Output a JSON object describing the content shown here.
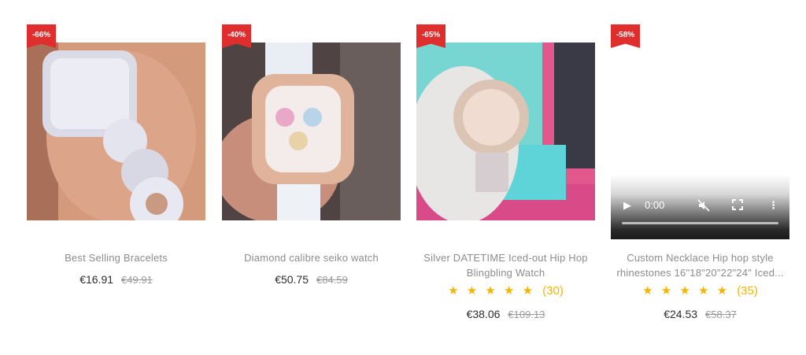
{
  "products": [
    {
      "badge": "-66%",
      "title_lines": [
        "Best Selling Bracelets"
      ],
      "price": "€16.91",
      "old_price": "€49.91",
      "colors": {
        "bg": "#c98a6e",
        "fg": "#e8e8f0"
      }
    },
    {
      "badge": "-40%",
      "title_lines": [
        "Diamond calibre seiko watch"
      ],
      "price": "€50.75",
      "old_price": "€84.59",
      "colors": {
        "bg": "#5a4a48",
        "fg": "#f2e6e0"
      }
    },
    {
      "badge": "-65%",
      "title_lines": [
        "Silver DATETIME Iced-out Hip Hop",
        "Blingbling Watch"
      ],
      "rating_stars": "★ ★ ★ ★ ★",
      "rating_count": "(30)",
      "price": "€38.06",
      "old_price": "€109.13",
      "colors": {
        "bg": "#6fd0cc",
        "fg": "#e0c8b0"
      }
    },
    {
      "badge": "-58%",
      "title_lines": [
        "Custom Necklace Hip hop style",
        "rhinestones 16\"18\"20\"22\"24\" Iced..."
      ],
      "rating_stars": "★ ★ ★ ★ ★",
      "rating_count": "(35)",
      "price": "€24.53",
      "old_price": "€58.37",
      "video": {
        "time": "0:00",
        "progress": 0
      }
    }
  ]
}
